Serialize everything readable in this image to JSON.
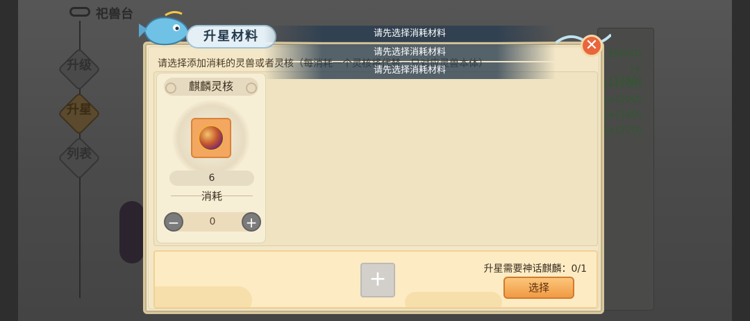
{
  "background": {
    "title": "祀兽台",
    "tabs": [
      {
        "label": "升级",
        "active": false
      },
      {
        "label": "升星",
        "active": true
      },
      {
        "label": "列表",
        "active": false
      }
    ],
    "stats": [
      "39600)",
      ")+(1760)",
      ")+(200)",
      ")+(200)",
      ")+(180)",
      ")+(220)"
    ]
  },
  "dialog": {
    "title": "升星材料",
    "instruction": "请选择添加消耗的灵兽或者灵核（每消耗一个灵核将代替一只对应灵兽本体）",
    "material_card": {
      "title": "麒麟灵核",
      "icon": "spirit-core-orb-icon",
      "owned_count": "6",
      "consume_label": "消耗",
      "stepper_value": "0",
      "minus_symbol": "−",
      "plus_symbol": "+"
    },
    "bottom": {
      "add_symbol": "+",
      "requirement": "升星需要神话麒麟：0/1",
      "select_label": "选择"
    },
    "close_symbol": "✕"
  },
  "toasts": [
    "请先选择消耗材料",
    "请先选择消耗材料",
    "请先选择消耗材料"
  ],
  "colors": {
    "dialog_bg": "#f3e7c7",
    "accent_orange": "#f19a44",
    "close_red": "#e9663d",
    "toast_bg": "#283c50"
  }
}
